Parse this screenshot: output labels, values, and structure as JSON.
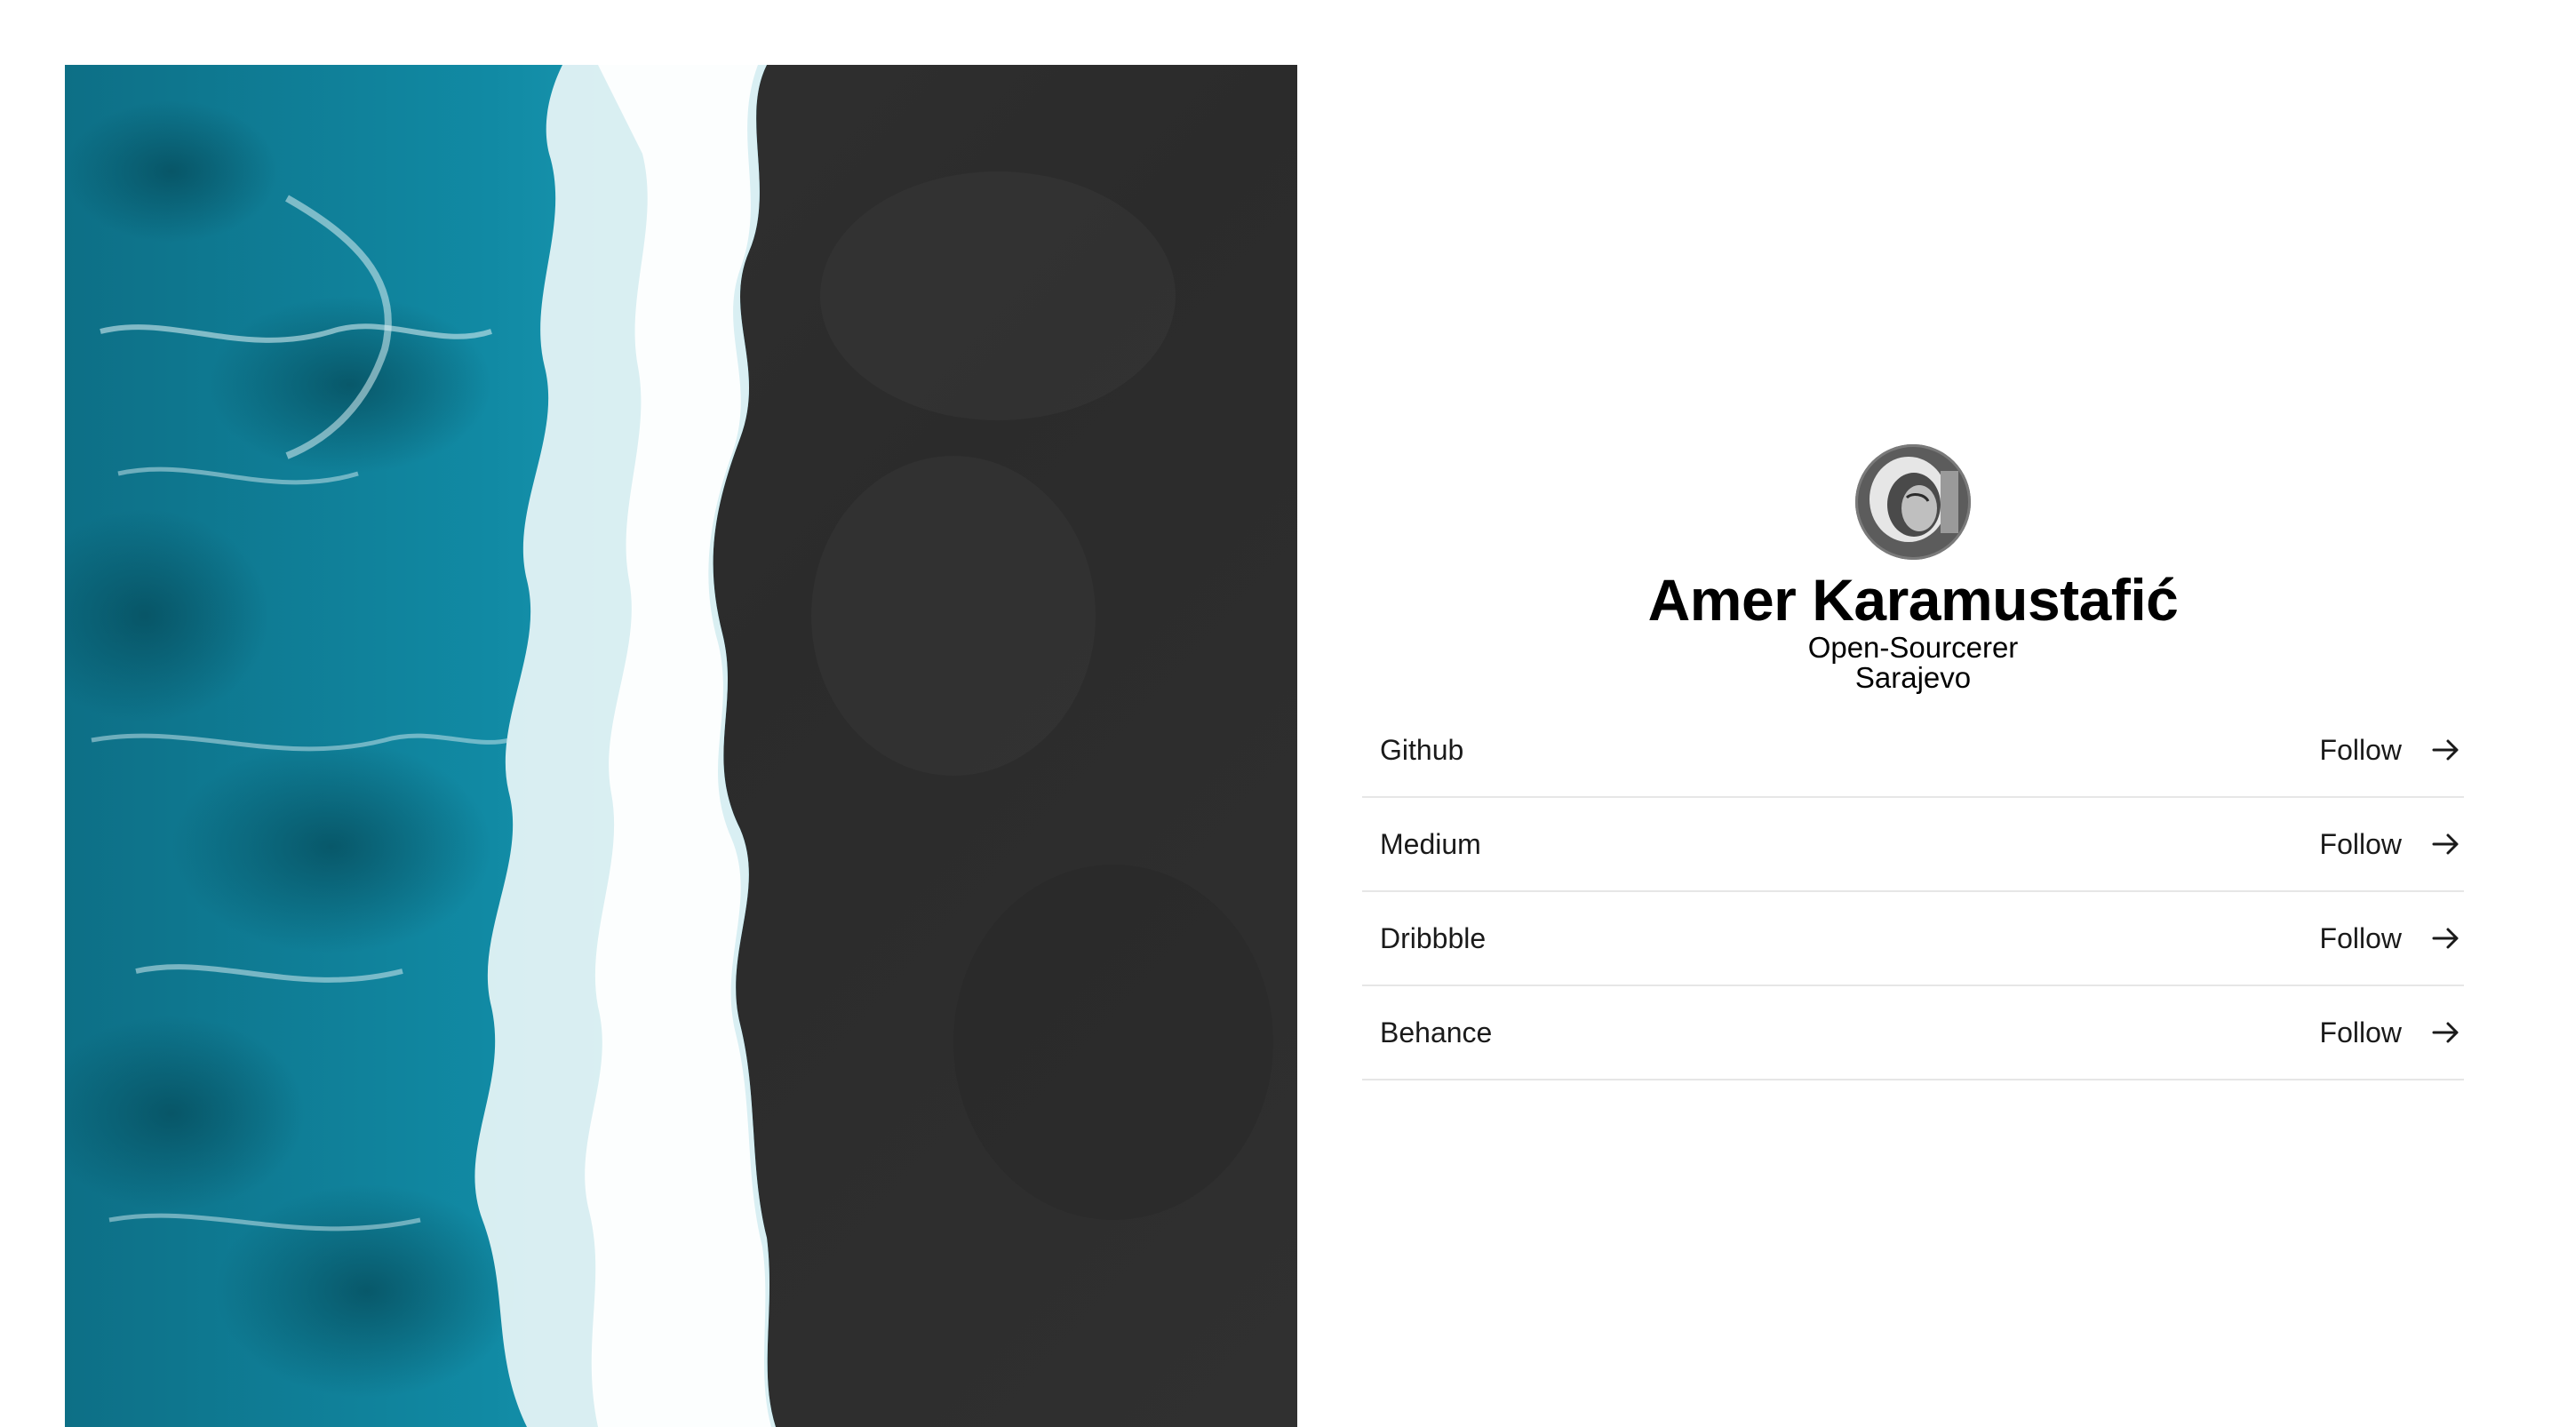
{
  "profile": {
    "name": "Amer Karamustafić",
    "role": "Open-Sourcerer",
    "location": "Sarajevo"
  },
  "links": [
    {
      "label": "Github",
      "action": "Follow",
      "icon": "arrow-right-icon"
    },
    {
      "label": "Medium",
      "action": "Follow",
      "icon": "arrow-right-icon"
    },
    {
      "label": "Dribbble",
      "action": "Follow",
      "icon": "arrow-right-icon"
    },
    {
      "label": "Behance",
      "action": "Follow",
      "icon": "arrow-right-icon"
    }
  ],
  "colors": {
    "ocean": "#0f7f99",
    "foam": "#e9f4f7",
    "sand": "#2e2e2e",
    "text": "#1a1a1a",
    "divider": "#e6e6e6"
  }
}
